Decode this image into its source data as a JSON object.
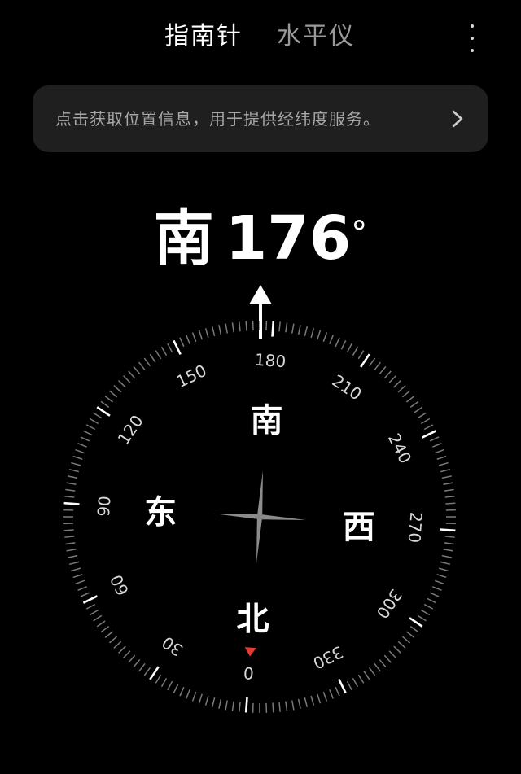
{
  "tabs": [
    {
      "label": "指南针",
      "active": true
    },
    {
      "label": "水平仪",
      "active": false
    }
  ],
  "menu": {
    "icon": "more-vertical-icon"
  },
  "banner": {
    "text": "点击获取位置信息，用于提供经纬度服务。",
    "icon": "chevron-right-icon"
  },
  "heading": {
    "direction": "南",
    "degrees": "176",
    "unit": "°"
  },
  "compass": {
    "heading_degrees": 176,
    "bearing_labels": [
      "180",
      "210",
      "240",
      "270",
      "300",
      "330",
      "0",
      "30",
      "60",
      "90",
      "120",
      "150"
    ],
    "cardinals": {
      "south": "南",
      "west": "西",
      "north": "北",
      "east": "东"
    },
    "north_marker_color": "#e53935"
  },
  "colors": {
    "background": "#000000",
    "banner_bg": "#1f1f1f",
    "north_marker": "#e53935"
  }
}
